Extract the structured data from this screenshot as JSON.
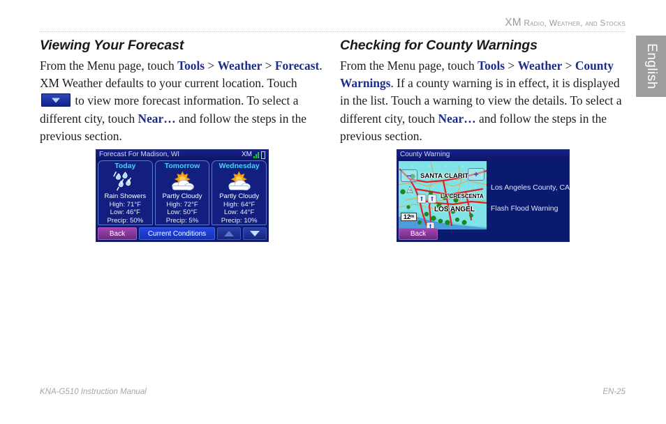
{
  "header": {
    "running_head_first": "XM",
    "running_head_rest": " Radio, Weather, and Stocks",
    "running_head_full": "XM Radio, Weather, and Stocks"
  },
  "side_tab": {
    "label": "English"
  },
  "left_column": {
    "title": "Viewing Your Forecast",
    "para_1a": "From the Menu page, touch ",
    "kw_tools": "Tools",
    "sep_1": " > ",
    "kw_weather": "Weather",
    "sep_2": " > ",
    "kw_forecast": "Forecast",
    "para_1b": ". XM Weather defaults to your current location. Touch ",
    "para_1c": " to view more forecast information. To select a different city, touch ",
    "kw_near": "Near…",
    "para_1d": " and follow the steps in the previous section."
  },
  "right_column": {
    "title": "Checking for County Warnings",
    "para_1a": "From the Menu page, touch ",
    "kw_tools": "Tools",
    "sep_1": " > ",
    "kw_weather": "Weather",
    "sep_2": " > ",
    "kw_county_warnings": "County Warnings",
    "para_1b": ". If a county warning is in effect, it is displayed in the list. Touch a warning to view the details. To select a different city, touch ",
    "kw_near": "Near…",
    "para_1c": " and follow the steps in the previous section."
  },
  "forecast_screen": {
    "title": "Forecast For Madison, WI",
    "xm_label": "XM",
    "columns": [
      {
        "day": "Today",
        "icon": "rain-showers-icon",
        "condition": "Rain Showers",
        "high": "High: 71°F",
        "low": "Low: 46°F",
        "precip": "Precip: 50%"
      },
      {
        "day": "Tomorrow",
        "icon": "partly-cloudy-icon",
        "condition": "Partly Cloudy",
        "high": "High: 72°F",
        "low": "Low: 50°F",
        "precip": "Precip: 5%"
      },
      {
        "day": "Wednesday",
        "icon": "partly-cloudy-icon",
        "condition": "Partly Cloudy",
        "high": "High: 64°F",
        "low": "Low: 44°F",
        "precip": "Precip: 10%"
      }
    ],
    "buttons": {
      "back": "Back",
      "current_conditions": "Current Conditions",
      "scroll_up": "scroll-up-arrow",
      "scroll_down": "scroll-down-arrow"
    }
  },
  "county_screen": {
    "title": "County Warning",
    "warning_location": "Los Angeles County, CA",
    "warning_type": "Flash Flood Warning",
    "back_button": "Back",
    "map": {
      "scale": "12ᵐ",
      "zoom_out": "−",
      "zoom_in": "+",
      "labels": [
        "SANTA CLARIT",
        "LA CRESCENTA",
        "LOS ANGEL"
      ]
    }
  },
  "footer": {
    "left": "KNA-G510 Instruction Manual",
    "right": "EN-25"
  },
  "colors": {
    "keyword_blue": "#1b2d8f",
    "device_bg": "#0a1a6e",
    "day_cyan": "#49d2f7",
    "back_purple": "#a144b4",
    "map_water": "#7fe3e8",
    "tab_gray": "#9d9d9d"
  }
}
